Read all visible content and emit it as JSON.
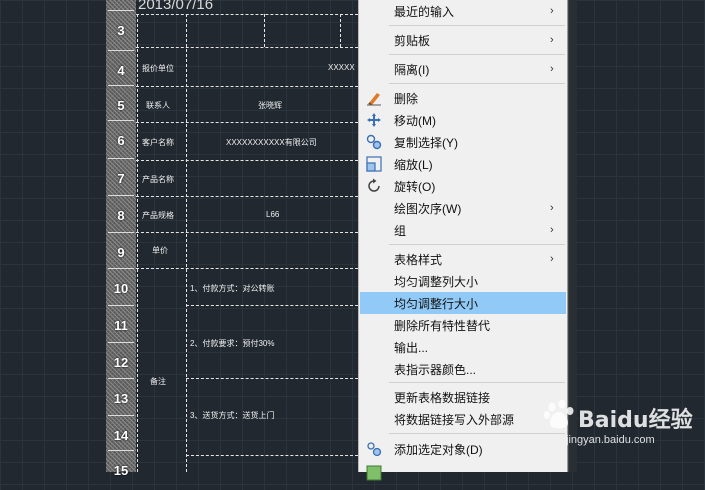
{
  "cad": {
    "date": "2013/07/16",
    "row_numbers": [
      "3",
      "4",
      "5",
      "6",
      "7",
      "8",
      "9",
      "10",
      "11",
      "12",
      "13",
      "14",
      "15"
    ],
    "cells": {
      "r4_label": "报价单位",
      "r4_value": "XXXXX",
      "r5_label": "联系人",
      "r5_value": "张晓辉",
      "r6_label": "客户名称",
      "r6_value": "XXXXXXXXXXX有限公司",
      "r7_label": "产品名称",
      "r8_label": "产品规格",
      "r8_value": "L66",
      "r9_label": "单价",
      "r10_value": "1、付款方式：对公转账",
      "r12_value": "2、付款要求：预付30%",
      "r13_label": "备注",
      "r14_value": "3、送货方式：送货上门"
    }
  },
  "context_menu": {
    "items": [
      {
        "label": "最近的输入",
        "submenu": true
      },
      {
        "label": "剪贴板",
        "submenu": true
      },
      {
        "label": "隔离(I)",
        "submenu": true
      },
      {
        "label": "删除",
        "icon": "eraser-icon"
      },
      {
        "label": "移动(M)",
        "icon": "move-icon"
      },
      {
        "label": "复制选择(Y)",
        "icon": "copy-icon"
      },
      {
        "label": "缩放(L)",
        "icon": "scale-icon"
      },
      {
        "label": "旋转(O)",
        "icon": "rotate-icon"
      },
      {
        "label": "绘图次序(W)",
        "submenu": true
      },
      {
        "label": "组",
        "submenu": true
      },
      {
        "label": "表格样式",
        "submenu": true
      },
      {
        "label": "均匀调整列大小"
      },
      {
        "label": "均匀调整行大小",
        "highlighted": true
      },
      {
        "label": "删除所有特性替代"
      },
      {
        "label": "输出..."
      },
      {
        "label": "表指示器颜色..."
      },
      {
        "label": "更新表格数据链接"
      },
      {
        "label": "将数据链接写入外部源"
      },
      {
        "label": "添加选定对象(D)",
        "icon": "add-selected-icon"
      }
    ],
    "arrow_glyph": "›",
    "highlight_color": "#91c9f7"
  },
  "watermark": {
    "logo": "Baidu经验",
    "sub": "jingyan.baidu.com"
  }
}
